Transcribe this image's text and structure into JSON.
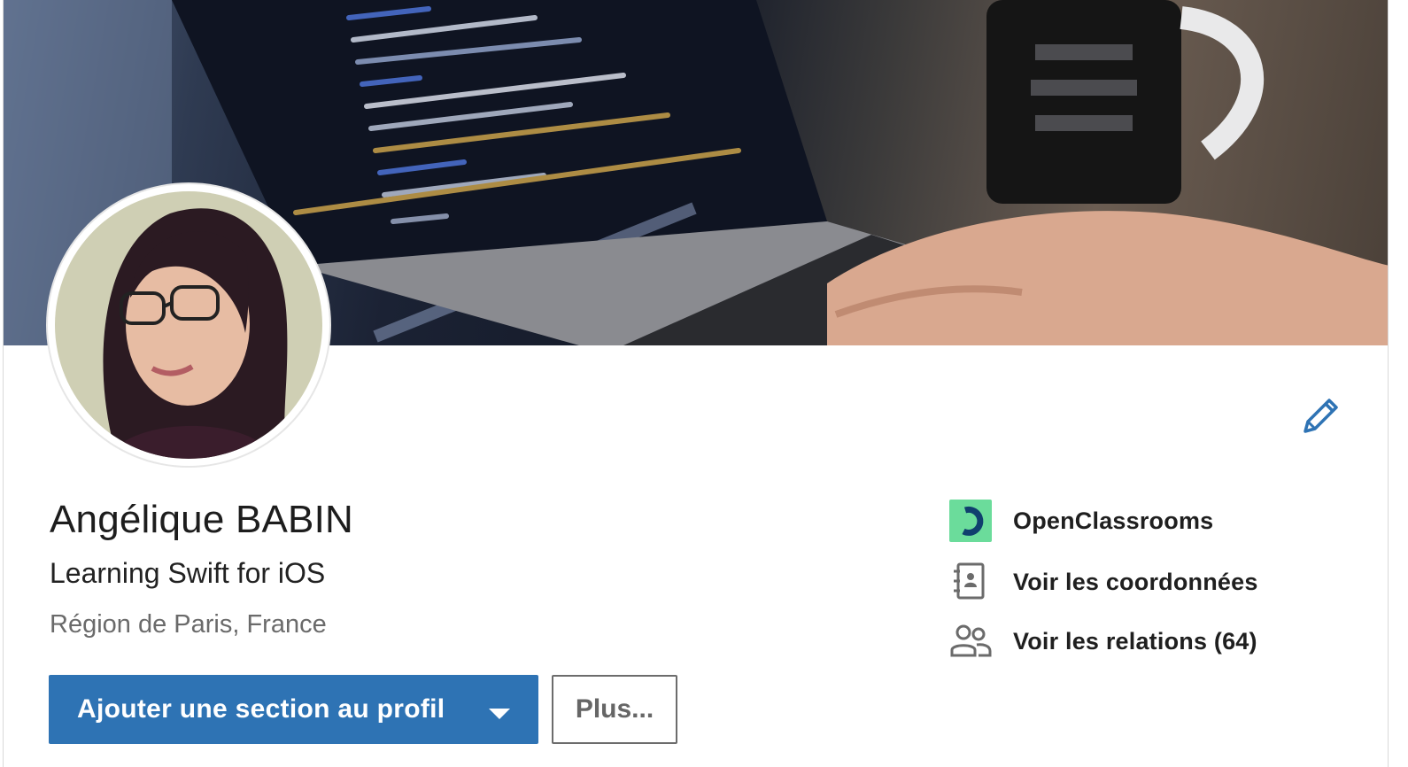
{
  "profile": {
    "name": "Angélique BABIN",
    "headline": "Learning Swift for iOS",
    "location": "Région de Paris, France"
  },
  "actions": {
    "add_section_label": "Ajouter une section au profil",
    "more_label": "Plus..."
  },
  "side_links": {
    "company": "OpenClassrooms",
    "contact_info": "Voir les coordonnées",
    "connections": "Voir les relations (64)"
  },
  "icons": {
    "edit": "pencil-icon",
    "company_logo": "openclassrooms-logo",
    "contact": "address-book-icon",
    "connections": "people-icon",
    "dropdown": "caret-down-icon"
  },
  "colors": {
    "primary_button": "#2e73b4",
    "edit_icon": "#2e73b4",
    "company_logo_bg": "#6bdc9b",
    "company_logo_mark": "#103f6e"
  }
}
